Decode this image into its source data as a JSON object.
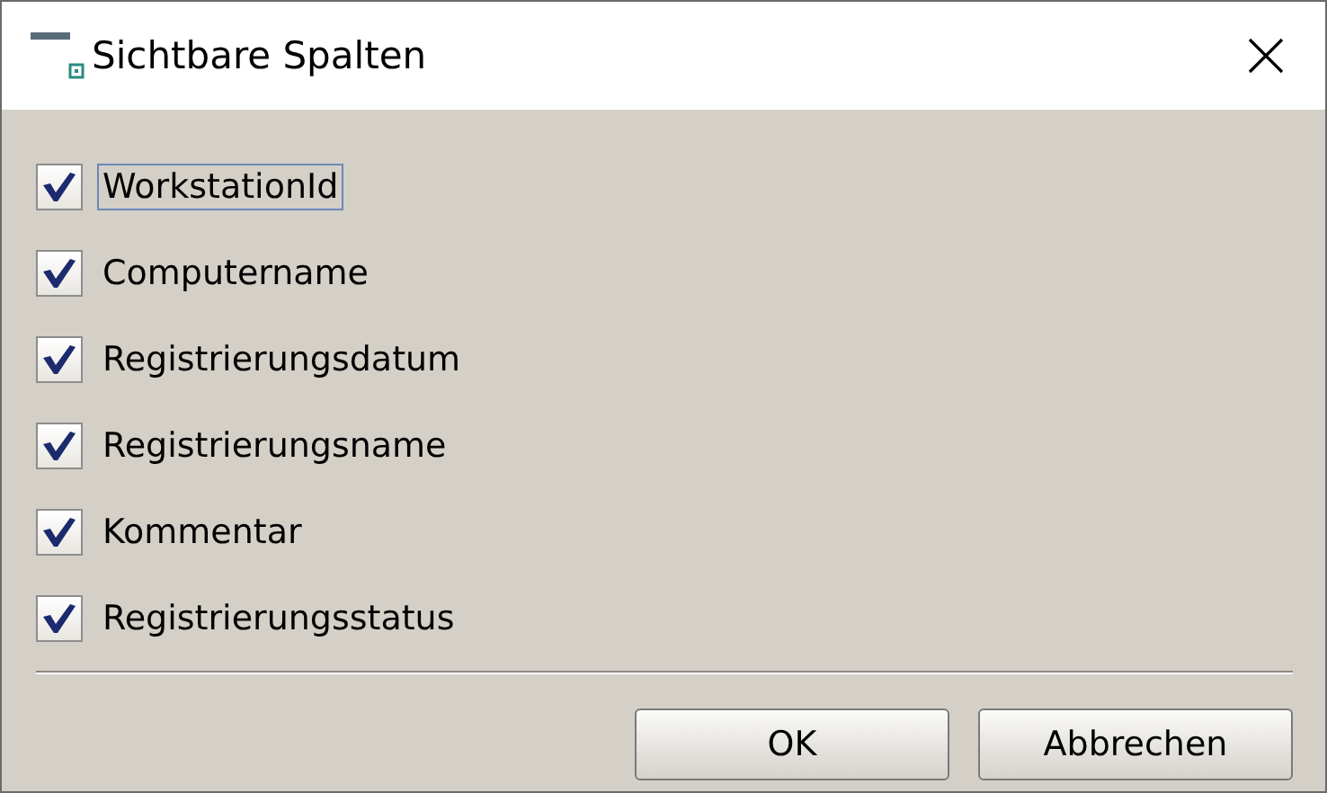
{
  "window": {
    "title": "Sichtbare Spalten"
  },
  "columns": [
    {
      "label": "WorkstationId",
      "checked": true,
      "focused": true
    },
    {
      "label": "Computername",
      "checked": true,
      "focused": false
    },
    {
      "label": "Registrierungsdatum",
      "checked": true,
      "focused": false
    },
    {
      "label": "Registrierungsname",
      "checked": true,
      "focused": false
    },
    {
      "label": "Kommentar",
      "checked": true,
      "focused": false
    },
    {
      "label": "Registrierungsstatus",
      "checked": true,
      "focused": false
    }
  ],
  "buttons": [
    "OK",
    "Abbrechen"
  ]
}
